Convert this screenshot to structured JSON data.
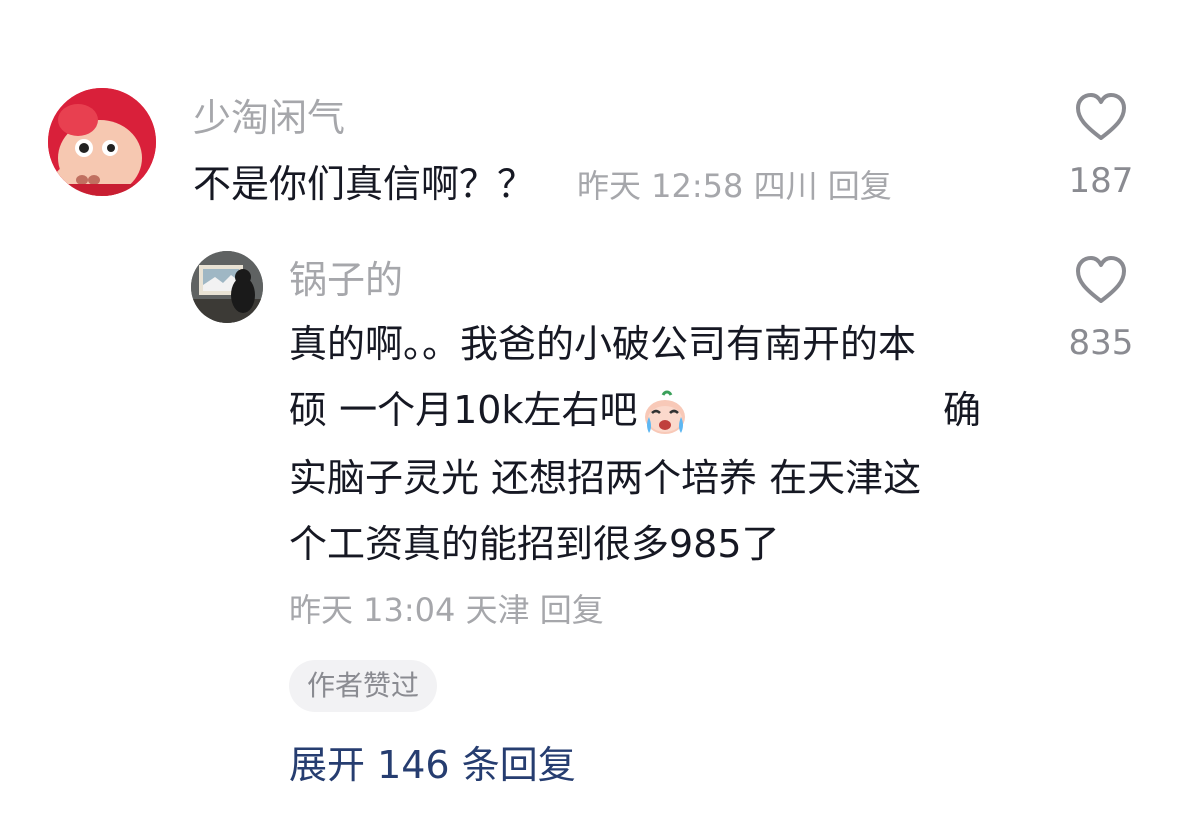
{
  "comments": [
    {
      "username": "少淘闲气",
      "text": "不是你们真信啊？？",
      "meta": "昨天 12:58 四川 回复",
      "likes": "187"
    },
    {
      "username": "锅子的",
      "lines": [
        "真的啊。。我爸的小破公司有南开的本",
        "硕 一个月10k左右吧",
        "实脑子灵光 还想招两个培养 在天津这",
        "个工资真的能招到很多985了",
        "确"
      ],
      "meta": "昨天 13:04 天津 回复",
      "likes": "835",
      "badge": "作者赞过"
    }
  ],
  "expand": {
    "label": "展开 146 条回复"
  },
  "icons": {
    "like": "heart-outline-icon",
    "emoji": "crying-face-icon"
  },
  "colors": {
    "username": "#a6a7ab",
    "text": "#161823",
    "meta": "#a6a7ab",
    "expand": "#263d70",
    "badge_bg": "#f2f2f4"
  }
}
